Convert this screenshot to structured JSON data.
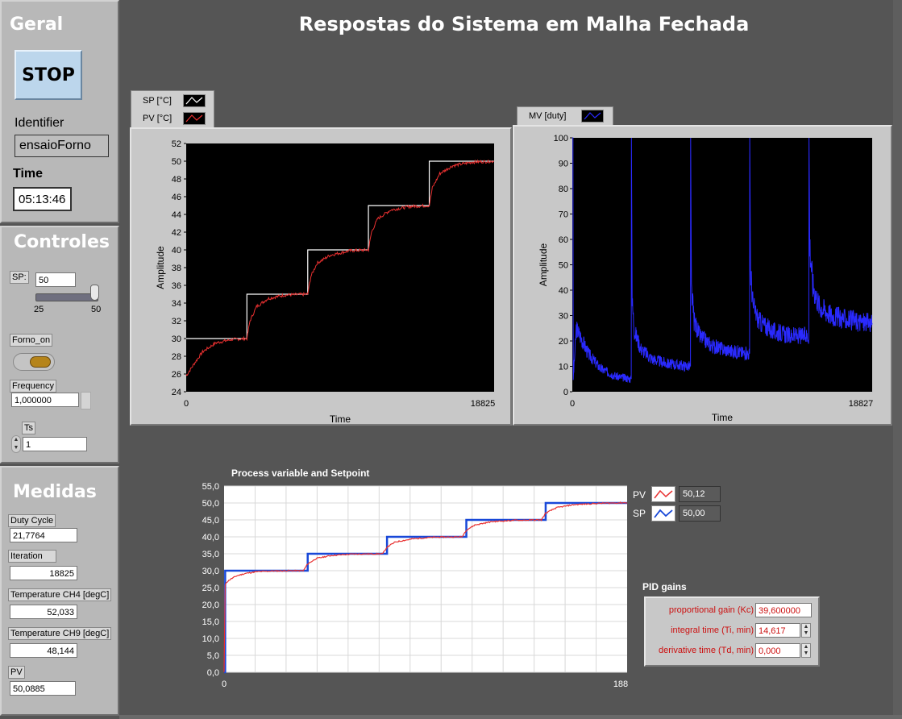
{
  "page_title": "Respostas do Sistema em Malha Fechada",
  "geral": {
    "title": "Geral",
    "stop_label": "STOP",
    "identifier_label": "Identifier",
    "identifier_value": "ensaioForno",
    "time_label": "Time",
    "time_value": "05:13:46"
  },
  "controles": {
    "title": "Controles",
    "sp_label": "SP:",
    "sp_value": "50",
    "slider_min": "25",
    "slider_max": "50",
    "slider_level": 1.0,
    "forno_label": "Forno_on",
    "frequency_label": "Frequency",
    "frequency_value": "1,000000",
    "ts_label": "Ts",
    "ts_value": "1"
  },
  "medidas": {
    "title": "Medidas",
    "duty_label": "Duty Cycle",
    "duty_value": "21,7764",
    "iteration_label": "Iteration",
    "iteration_value": "18825",
    "ch4_label": "Temperature CH4 [degC]",
    "ch4_value": "52,033",
    "ch9_label": "Temperature CH9 [degC]",
    "ch9_value": "48,144",
    "pv_label": "PV",
    "pv_value": "50,0885"
  },
  "pv_sp_gauge": {
    "pv_label": "PV",
    "pv_value": "50,12",
    "sp_label": "SP",
    "sp_value": "50,00"
  },
  "pid": {
    "title": "PID gains",
    "kc_label": "proportional gain (Kc)",
    "kc_value": "39,600000",
    "ti_label": "integral time (Ti, min)",
    "ti_value": "14,617",
    "td_label": "derivative time (Td, min)",
    "td_value": "0,000"
  },
  "colors": {
    "pv_red": "#e83030",
    "sp_white": "#ffffff",
    "mv_blue": "#2a2aff",
    "sp_blue": "#1848d8"
  },
  "chart_data": [
    {
      "type": "line",
      "xlabel": "Time",
      "ylabel": "Amplitude",
      "xlim": [
        0,
        18825
      ],
      "ylim": [
        24,
        52
      ],
      "x_ticks": [
        "0",
        "18825"
      ],
      "y_ticks": [
        "24",
        "26",
        "28",
        "30",
        "32",
        "34",
        "36",
        "38",
        "40",
        "42",
        "44",
        "46",
        "48",
        "50",
        "52"
      ],
      "series": [
        {
          "name": "SP [°C]",
          "x": [
            0,
            3710,
            3710,
            7430,
            7430,
            11140,
            11140,
            14860,
            14860,
            18825
          ],
          "values": [
            30,
            30,
            35,
            35,
            40,
            40,
            45,
            45,
            50,
            50
          ]
        },
        {
          "name": "PV [°C]",
          "x": [
            0,
            500,
            1000,
            1800,
            2800,
            3710,
            3900,
            4300,
            5000,
            6000,
            7430,
            7620,
            8000,
            8800,
            10000,
            11140,
            11330,
            11700,
            12500,
            13700,
            14860,
            15050,
            15500,
            16300,
            17500,
            18825
          ],
          "values": [
            25.8,
            27.2,
            28.5,
            29.5,
            29.9,
            30.0,
            32.0,
            33.6,
            34.5,
            34.9,
            35.0,
            37.0,
            38.5,
            39.4,
            39.9,
            40.0,
            42.0,
            43.5,
            44.5,
            44.9,
            45.0,
            47.0,
            48.6,
            49.5,
            49.9,
            50.0
          ]
        }
      ]
    },
    {
      "type": "line",
      "xlabel": "Time",
      "ylabel": "Amplitude",
      "xlim": [
        0,
        18827
      ],
      "ylim": [
        0,
        100
      ],
      "x_ticks": [
        "0",
        "18827"
      ],
      "y_ticks": [
        "0",
        "10",
        "20",
        "30",
        "40",
        "50",
        "60",
        "70",
        "80",
        "90",
        "100"
      ],
      "series": [
        {
          "name": "MV [duty]",
          "x": [
            0,
            40,
            60,
            250,
            500,
            1000,
            1800,
            2800,
            3700,
            3710,
            3760,
            3900,
            4300,
            5000,
            6000,
            7420,
            7430,
            7480,
            7650,
            8000,
            8800,
            10000,
            11130,
            11140,
            11190,
            11350,
            11700,
            12500,
            13700,
            14850,
            14860,
            14910,
            15100,
            15500,
            16300,
            17500,
            18827
          ],
          "values": [
            100,
            100,
            5,
            25,
            22,
            15,
            9,
            6,
            5,
            100,
            35,
            24,
            17,
            13,
            11,
            10,
            100,
            40,
            28,
            22,
            18,
            16,
            15,
            100,
            48,
            34,
            28,
            24,
            22,
            22,
            100,
            58,
            42,
            34,
            30,
            28,
            27
          ]
        }
      ]
    },
    {
      "type": "line",
      "title": "Process variable and Setpoint",
      "xlim": [
        0,
        188
      ],
      "ylim": [
        0,
        55
      ],
      "x_ticks": [
        "0",
        "188"
      ],
      "y_ticks": [
        "0,0",
        "5,0",
        "10,0",
        "15,0",
        "20,0",
        "25,0",
        "30,0",
        "35,0",
        "40,0",
        "45,0",
        "50,0",
        "55,0"
      ],
      "series": [
        {
          "name": "PV",
          "x": [
            0,
            0.5,
            1,
            3,
            6,
            10,
            15,
            22,
            30,
            37,
            39,
            43,
            50,
            60,
            74,
            76,
            80,
            88,
            98,
            111,
            113,
            117,
            125,
            136,
            148,
            150,
            155,
            163,
            175,
            188
          ],
          "values": [
            0,
            25.5,
            26.5,
            27.5,
            28.5,
            29.2,
            29.7,
            29.9,
            30.0,
            30.0,
            32.0,
            33.6,
            34.5,
            34.9,
            35.0,
            37.0,
            38.5,
            39.4,
            39.9,
            40.0,
            42.0,
            43.5,
            44.5,
            44.9,
            45.0,
            47.0,
            48.6,
            49.5,
            49.9,
            50.1
          ]
        },
        {
          "name": "SP",
          "x": [
            0,
            0.5,
            0.5,
            39,
            39,
            76,
            76,
            113,
            113,
            150,
            150,
            188
          ],
          "values": [
            0,
            0,
            30,
            30,
            35,
            35,
            40,
            40,
            45,
            45,
            50,
            50
          ]
        }
      ]
    }
  ]
}
